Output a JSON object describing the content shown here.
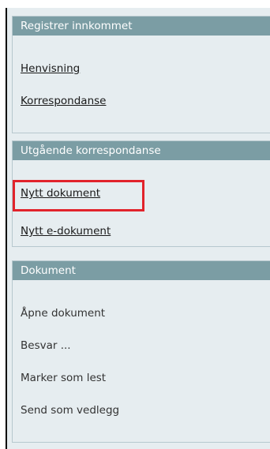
{
  "panels": [
    {
      "title": "Registrer innkommet",
      "items": [
        "Henvisning",
        "Korrespondanse"
      ]
    },
    {
      "title": "Utgående korrespondanse",
      "items": [
        "Nytt dokument",
        "Nytt e-dokument"
      ]
    },
    {
      "title": "Dokument",
      "items": [
        "Åpne dokument",
        "Besvar ...",
        "Marker som lest",
        "Send som vedlegg"
      ]
    }
  ],
  "colors": {
    "header_bg": "#7b9da4",
    "panel_bg": "#e6edf0",
    "highlight": "#e1232b"
  },
  "highlighted_item": "Nytt dokument"
}
